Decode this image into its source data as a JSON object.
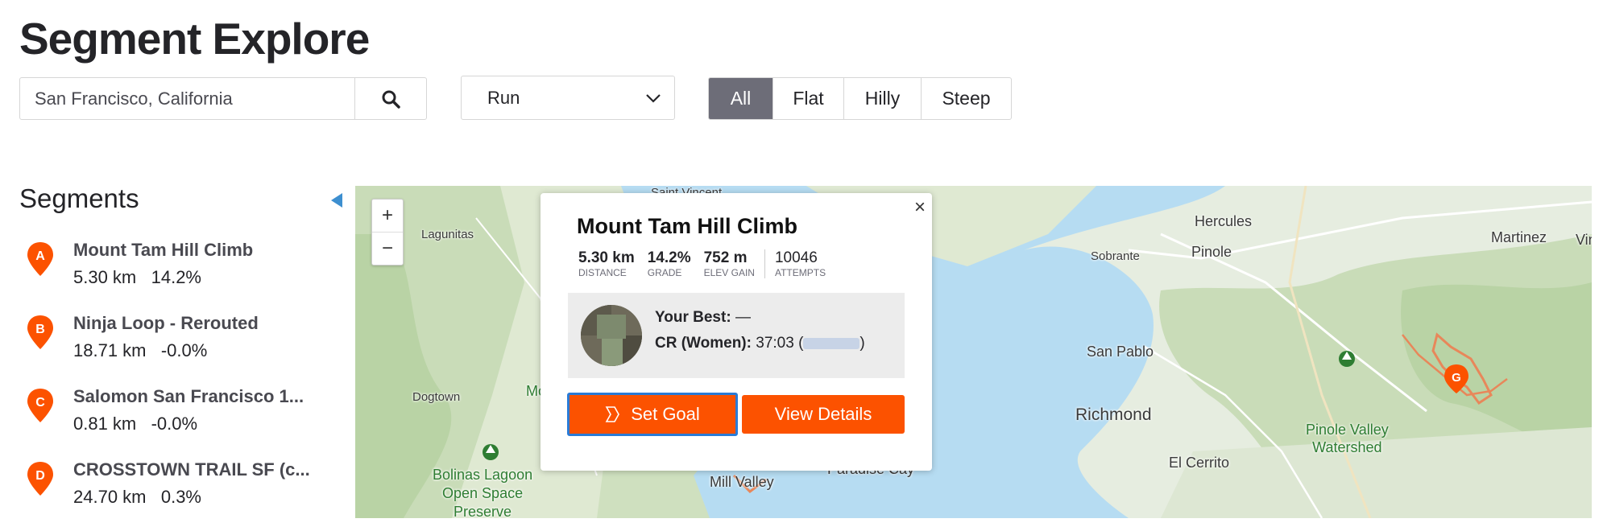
{
  "page": {
    "title": "Segment Explore"
  },
  "search": {
    "value": "San Francisco, California",
    "icon": "search-icon"
  },
  "filters": {
    "sport": {
      "selected": "Run",
      "icon": "chevron-down-icon"
    },
    "terrain": {
      "options": [
        {
          "label": "All",
          "active": true
        },
        {
          "label": "Flat",
          "active": false
        },
        {
          "label": "Hilly",
          "active": false
        },
        {
          "label": "Steep",
          "active": false
        }
      ]
    }
  },
  "sidebar": {
    "heading": "Segments",
    "items": [
      {
        "letter": "A",
        "name": "Mount Tam Hill Climb",
        "distance": "5.30 km",
        "grade": "14.2%"
      },
      {
        "letter": "B",
        "name": "Ninja Loop - Rerouted",
        "distance": "18.71 km",
        "grade": "-0.0%"
      },
      {
        "letter": "C",
        "name": "Salomon San Francisco 1...",
        "distance": "0.81 km",
        "grade": "-0.0%"
      },
      {
        "letter": "D",
        "name": "CROSSTOWN TRAIL SF (c...",
        "distance": "24.70 km",
        "grade": "0.3%"
      }
    ]
  },
  "map": {
    "zoom_in": "+",
    "zoom_out": "−",
    "labels": {
      "saint_vincent": "Saint Vincent",
      "lagunitas": "Lagunitas",
      "dogtown": "Dogtown",
      "mo": "Mo",
      "bolinas_line1": "Bolinas Lagoon",
      "bolinas_line2": "Open Space",
      "bolinas_line3": "Preserve",
      "mill_valley": "Mill Valley",
      "paradise_cay": "Paradise Cay",
      "hercules": "Hercules",
      "sobrante": "Sobrante",
      "pinole": "Pinole",
      "martinez": "Martinez",
      "vine": "Vin",
      "san_pablo": "San Pablo",
      "richmond": "Richmond",
      "el_cerrito": "El Cerrito",
      "pinole_valley_line1": "Pinole Valley",
      "pinole_valley_line2": "Watershed",
      "marker_g": "G"
    },
    "colors": {
      "water": "#b6dcf2",
      "land": "#e8efe0",
      "hills": "#c9dcb8",
      "route": "#e8875a"
    }
  },
  "popup": {
    "close": "×",
    "title": "Mount Tam Hill Climb",
    "stats": [
      {
        "value": "5.30 km",
        "label": "Distance"
      },
      {
        "value": "14.2%",
        "label": "Grade"
      },
      {
        "value": "752 m",
        "label": "Elev Gain"
      },
      {
        "value": "10046",
        "label": "Attempts"
      }
    ],
    "your_best_label": "Your Best:",
    "your_best_value": "—",
    "cr_label": "CR (Women):",
    "cr_value": "37:03 (",
    "cr_suffix": ")",
    "set_goal": "Set Goal",
    "view_details": "View Details"
  },
  "theme": {
    "accent": "#fc5200",
    "focus": "#2a7bd6",
    "active_tab": "#6d6d78"
  }
}
